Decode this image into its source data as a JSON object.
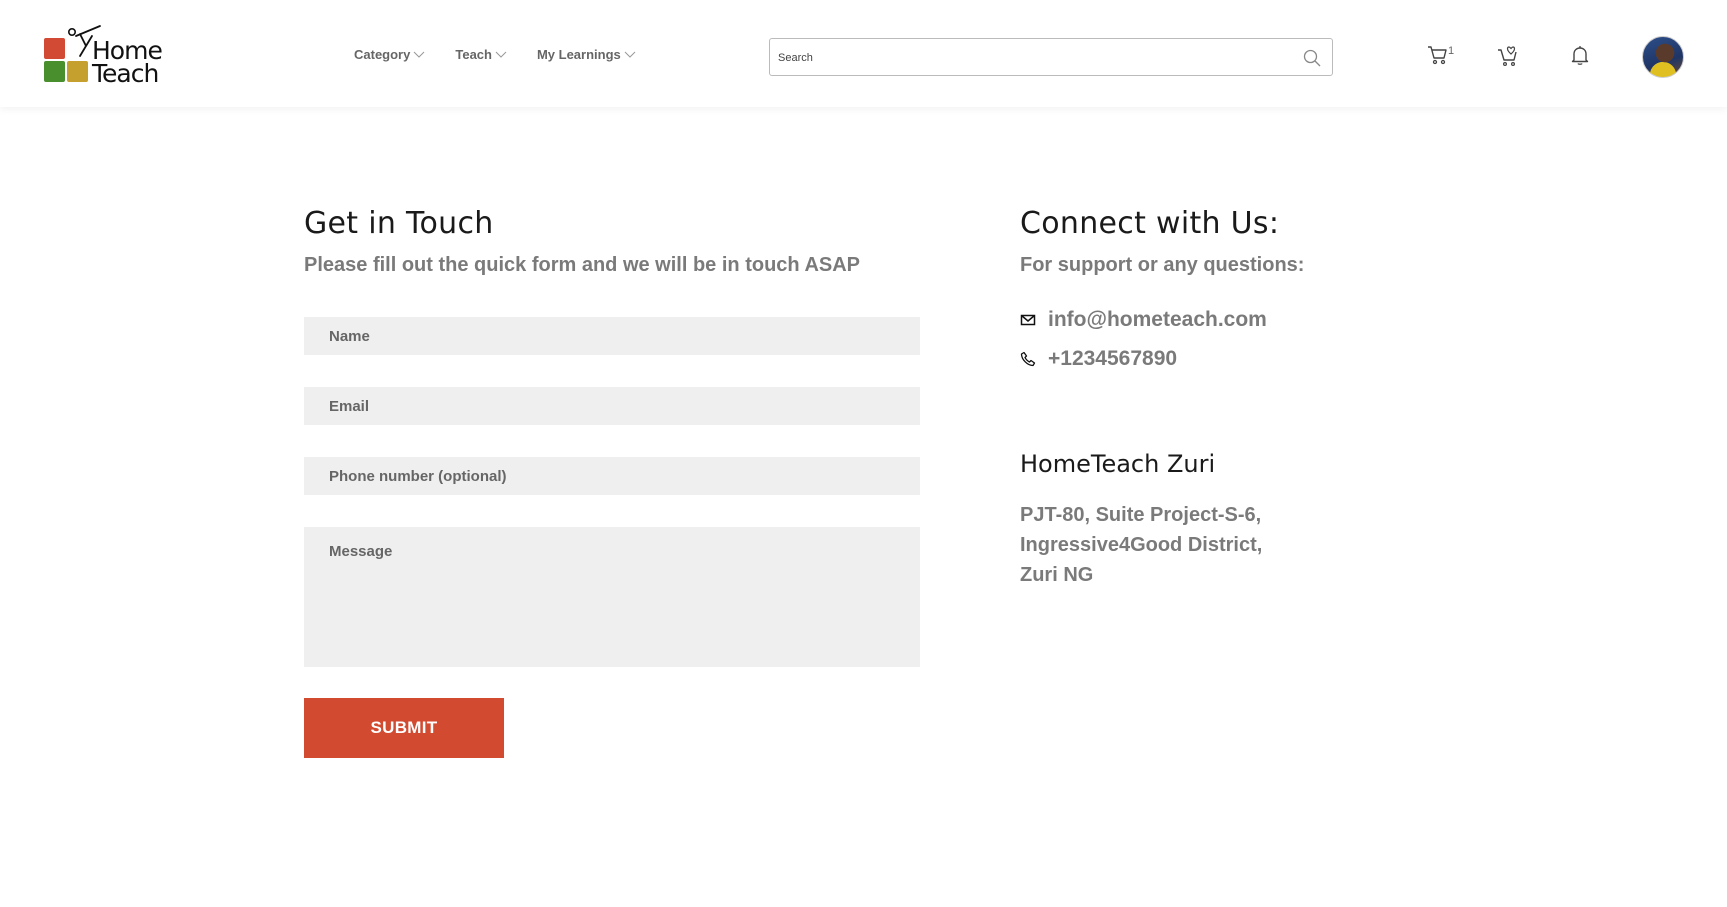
{
  "brand": {
    "line1": "Home",
    "line2": "Teach",
    "colors": {
      "red": "#d24a34",
      "green": "#4a8f2e",
      "gold": "#c6a02e"
    }
  },
  "nav": [
    {
      "label": "Category",
      "icon": "chevron-down-icon"
    },
    {
      "label": "Teach",
      "icon": "chevron-down-icon"
    },
    {
      "label": "My Learnings",
      "icon": "chevron-down-icon"
    }
  ],
  "search": {
    "placeholder": "Search",
    "icon": "search-icon"
  },
  "header_icons": {
    "cart_count": "1",
    "cart": "cart-icon",
    "wishlist_cart": "cart-heart-icon",
    "notifications": "bell-icon"
  },
  "form": {
    "title": "Get in Touch",
    "subtitle": "Please fill out the quick form and we will be in touch ASAP",
    "name_placeholder": "Name",
    "email_placeholder": "Email",
    "phone_placeholder": "Phone number (optional)",
    "message_placeholder": "Message",
    "submit_label": "SUBMIT",
    "accent": "#d24a2f"
  },
  "connect": {
    "title": "Connect with Us:",
    "subtitle": "For support or any questions:",
    "email": "info@hometeach.com",
    "phone": "+1234567890"
  },
  "office": {
    "title": "HomeTeach Zuri",
    "address": [
      "PJT-80, Suite Project-S-6,",
      "Ingressive4Good District,",
      "Zuri NG"
    ]
  }
}
